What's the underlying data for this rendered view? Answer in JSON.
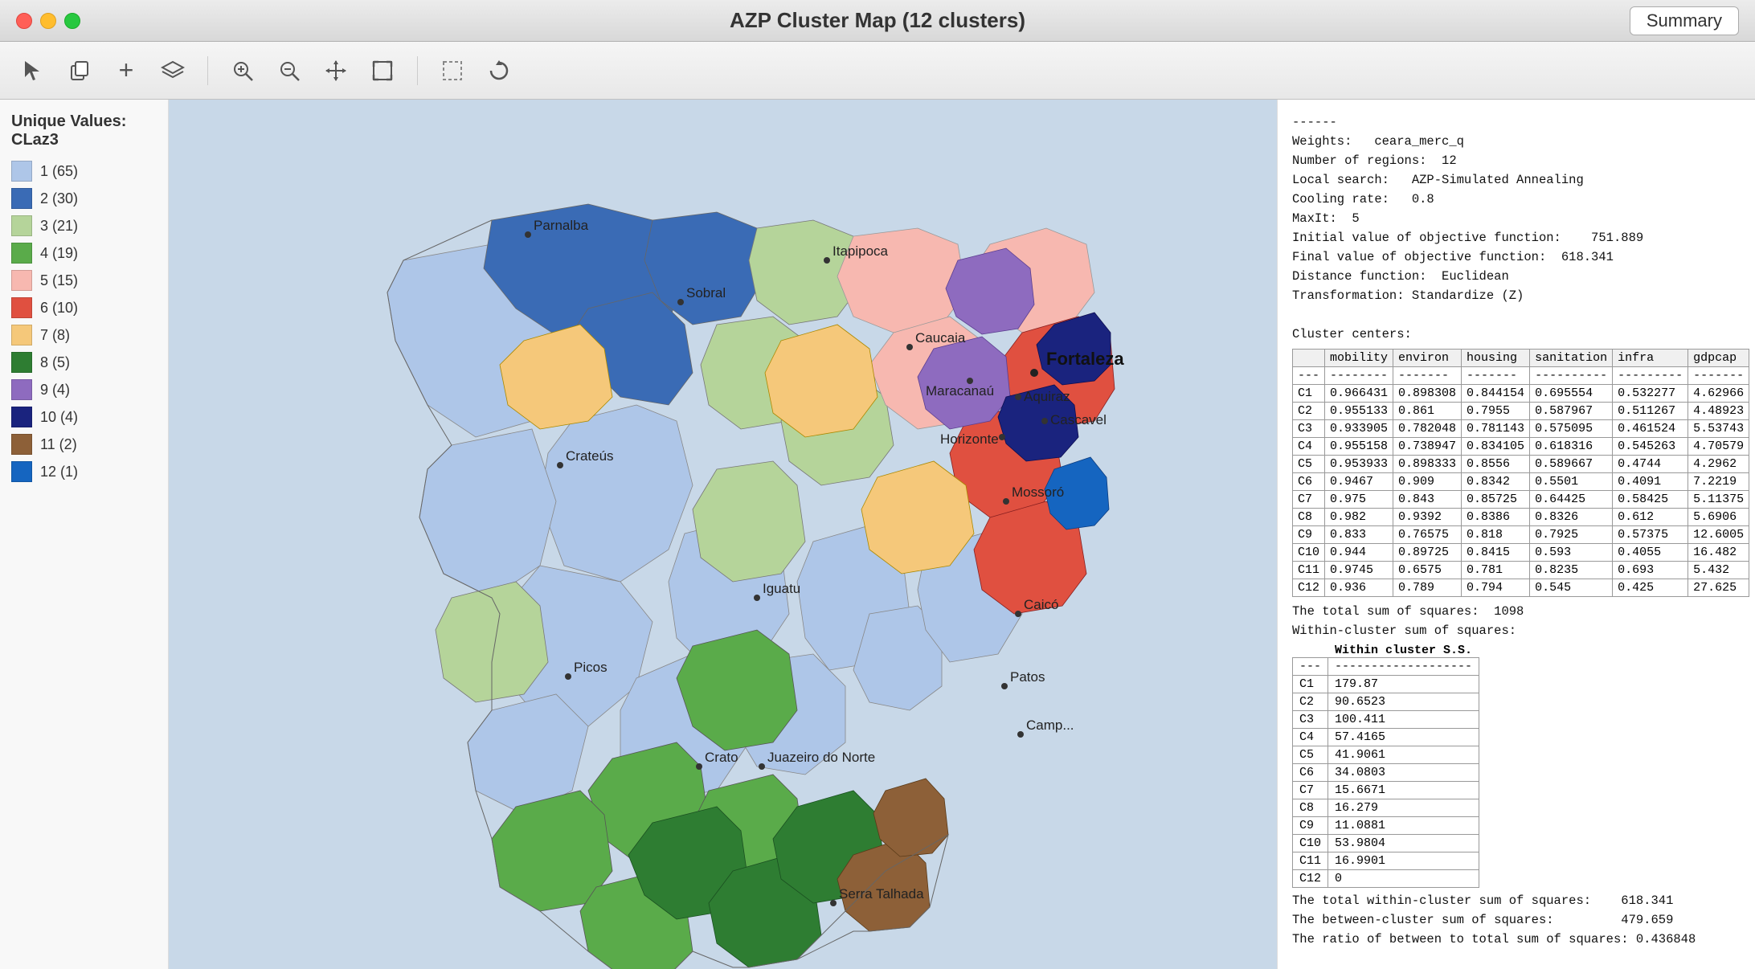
{
  "window": {
    "title": "AZP Cluster Map (12 clusters)",
    "summary_button": "Summary"
  },
  "traffic_lights": {
    "red": "close",
    "yellow": "minimize",
    "green": "maximize"
  },
  "toolbar": {
    "tools": [
      {
        "name": "select-tool",
        "icon": "↖",
        "label": "Select"
      },
      {
        "name": "copy-tool",
        "icon": "⧉",
        "label": "Copy"
      },
      {
        "name": "add-tool",
        "icon": "+",
        "label": "Add"
      },
      {
        "name": "layers-tool",
        "icon": "◈",
        "label": "Layers"
      },
      {
        "name": "zoom-in-tool",
        "icon": "🔍+",
        "label": "Zoom In"
      },
      {
        "name": "zoom-out-tool",
        "icon": "🔍-",
        "label": "Zoom Out"
      },
      {
        "name": "pan-tool",
        "icon": "✛",
        "label": "Pan"
      },
      {
        "name": "fullextent-tool",
        "icon": "⤢",
        "label": "Full Extent"
      },
      {
        "name": "select-region-tool",
        "icon": "⬚",
        "label": "Select Region"
      },
      {
        "name": "refresh-tool",
        "icon": "↺",
        "label": "Refresh"
      }
    ]
  },
  "legend": {
    "title": "Unique Values: CLaz3",
    "items": [
      {
        "label": "1 (65)",
        "color": "#aec6e8"
      },
      {
        "label": "2 (30)",
        "color": "#3a6bb5"
      },
      {
        "label": "3 (21)",
        "color": "#b5d49a"
      },
      {
        "label": "4 (19)",
        "color": "#5aab4a"
      },
      {
        "label": "5 (15)",
        "color": "#f7b8b0"
      },
      {
        "label": "6 (10)",
        "color": "#e05040"
      },
      {
        "label": "7 (8)",
        "color": "#f5c87a"
      },
      {
        "label": "8 (5)",
        "color": "#2e7d32"
      },
      {
        "label": "9 (4)",
        "color": "#8e6bbf"
      },
      {
        "label": "10 (4)",
        "color": "#1a237e"
      },
      {
        "label": "11 (2)",
        "color": "#8d6038"
      },
      {
        "label": "12 (1)",
        "color": "#1565c0"
      }
    ]
  },
  "summary": {
    "separator": "------",
    "weights": "ceara_merc_q",
    "num_regions": "12",
    "local_search": "AZP-Simulated Annealing",
    "cooling_rate": "0.8",
    "max_it": "5",
    "initial_obj": "751.889",
    "final_obj": "618.341",
    "distance_function": "Euclidean",
    "transformation": "Standardize (Z)",
    "cluster_centers_label": "Cluster centers:",
    "cluster_table": {
      "headers": [
        "",
        "mobility",
        "environ",
        "housing",
        "sanitation",
        "infra",
        "gdpcap"
      ],
      "rows": [
        [
          "C1",
          "0.966431",
          "0.898308",
          "0.844154",
          "0.695554",
          "0.532277",
          "4.62966"
        ],
        [
          "C2",
          "0.955133",
          "0.861",
          "0.7955",
          "0.587967",
          "0.511267",
          "4.48923"
        ],
        [
          "C3",
          "0.933905",
          "0.782048",
          "0.781143",
          "0.575095",
          "0.461524",
          "5.53743"
        ],
        [
          "C4",
          "0.955158",
          "0.738947",
          "0.834105",
          "0.618316",
          "0.545263",
          "4.70579"
        ],
        [
          "C5",
          "0.953933",
          "0.898333",
          "0.8556",
          "0.589667",
          "0.4744",
          "4.2962"
        ],
        [
          "C6",
          "0.9467",
          "0.909",
          "0.8342",
          "0.5501",
          "0.4091",
          "7.2219"
        ],
        [
          "C7",
          "0.975",
          "0.843",
          "0.85725",
          "0.64425",
          "0.58425",
          "5.11375"
        ],
        [
          "C8",
          "0.982",
          "0.9392",
          "0.8386",
          "0.8326",
          "0.612",
          "5.6906"
        ],
        [
          "C9",
          "0.833",
          "0.76575",
          "0.818",
          "0.7925",
          "0.57375",
          "12.6005"
        ],
        [
          "C10",
          "0.944",
          "0.89725",
          "0.8415",
          "0.593",
          "0.4055",
          "16.482"
        ],
        [
          "C11",
          "0.9745",
          "0.6575",
          "0.781",
          "0.8235",
          "0.693",
          "5.432"
        ],
        [
          "C12",
          "0.936",
          "0.789",
          "0.794",
          "0.545",
          "0.425",
          "27.625"
        ]
      ]
    },
    "total_ss": "1098",
    "within_cluster_ss_label": "Within-cluster sum of squares:",
    "within_table": {
      "headers": [
        "",
        "Within cluster S.S."
      ],
      "rows": [
        [
          "C1",
          "179.87"
        ],
        [
          "C2",
          "90.6523"
        ],
        [
          "C3",
          "100.411"
        ],
        [
          "C4",
          "57.4165"
        ],
        [
          "C5",
          "41.9061"
        ],
        [
          "C6",
          "34.0803"
        ],
        [
          "C7",
          "15.6671"
        ],
        [
          "C8",
          "16.279"
        ],
        [
          "C9",
          "11.0881"
        ],
        [
          "C10",
          "53.9804"
        ],
        [
          "C11",
          "16.9901"
        ],
        [
          "C12",
          "0"
        ]
      ]
    },
    "total_within_ss": "618.341",
    "between_cluster_ss": "479.659",
    "ratio": "0.436848"
  },
  "map": {
    "cities": [
      {
        "name": "Fortaleza",
        "bold": true
      },
      {
        "name": "Parnalba"
      },
      {
        "name": "Sobral"
      },
      {
        "name": "Itapipoca"
      },
      {
        "name": "Caucaia"
      },
      {
        "name": "Aquiraz"
      },
      {
        "name": "Maracanaú"
      },
      {
        "name": "Cascavel"
      },
      {
        "name": "Horizonte"
      },
      {
        "name": "Crateús"
      },
      {
        "name": "Mossoró"
      },
      {
        "name": "Iguatu"
      },
      {
        "name": "Caicó"
      },
      {
        "name": "Picos"
      },
      {
        "name": "Crato"
      },
      {
        "name": "Juazeiro do Norte"
      },
      {
        "name": "Patos"
      },
      {
        "name": "Serra Talhada"
      }
    ]
  }
}
